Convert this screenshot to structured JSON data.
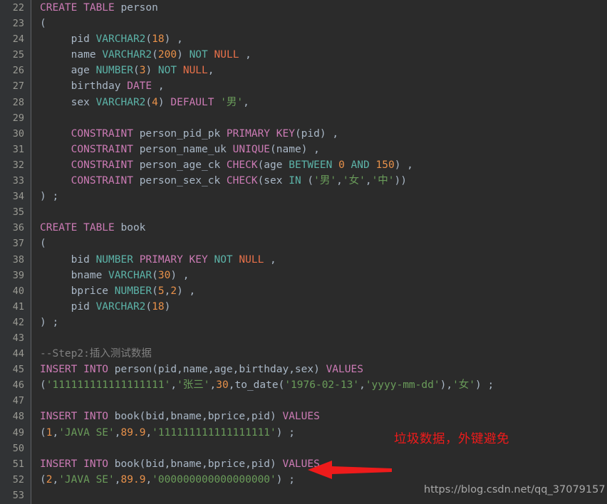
{
  "editor": {
    "background_color": "#2b2b2b",
    "gutter_color": "#313335",
    "gutter_rule_color": "#606366",
    "default_text_color": "#a9b7c6",
    "token_colors": {
      "keyword": "#cc7bb5",
      "type": "#5cb3a8",
      "null": "#e8714a",
      "number": "#e8914a",
      "string": "#6a9c5a",
      "comment": "#808080",
      "line_number": "#9a9a93"
    },
    "first_line_number": 22,
    "last_line_number": 53,
    "lines": [
      {
        "n": "22",
        "tokens": [
          {
            "t": "CREATE TABLE",
            "c": "kw"
          },
          {
            "t": " person",
            "c": "plain"
          }
        ]
      },
      {
        "n": "23",
        "tokens": [
          {
            "t": "(",
            "c": "paren"
          }
        ]
      },
      {
        "n": "24",
        "tokens": [
          {
            "t": "     pid ",
            "c": "plain"
          },
          {
            "t": "VARCHAR2",
            "c": "type"
          },
          {
            "t": "(",
            "c": "plain"
          },
          {
            "t": "18",
            "c": "num"
          },
          {
            "t": ") ,",
            "c": "plain"
          }
        ]
      },
      {
        "n": "25",
        "tokens": [
          {
            "t": "     name ",
            "c": "plain"
          },
          {
            "t": "VARCHAR2",
            "c": "type"
          },
          {
            "t": "(",
            "c": "plain"
          },
          {
            "t": "200",
            "c": "num"
          },
          {
            "t": ") ",
            "c": "plain"
          },
          {
            "t": "NOT",
            "c": "type"
          },
          {
            "t": " ",
            "c": "plain"
          },
          {
            "t": "NULL",
            "c": "null"
          },
          {
            "t": " ,",
            "c": "plain"
          }
        ]
      },
      {
        "n": "26",
        "tokens": [
          {
            "t": "     age ",
            "c": "plain"
          },
          {
            "t": "NUMBER",
            "c": "type"
          },
          {
            "t": "(",
            "c": "plain"
          },
          {
            "t": "3",
            "c": "num"
          },
          {
            "t": ") ",
            "c": "plain"
          },
          {
            "t": "NOT",
            "c": "type"
          },
          {
            "t": " ",
            "c": "plain"
          },
          {
            "t": "NULL",
            "c": "null"
          },
          {
            "t": ",",
            "c": "plain"
          }
        ]
      },
      {
        "n": "27",
        "tokens": [
          {
            "t": "     birthday ",
            "c": "plain"
          },
          {
            "t": "DATE",
            "c": "kw"
          },
          {
            "t": " ,",
            "c": "plain"
          }
        ]
      },
      {
        "n": "28",
        "tokens": [
          {
            "t": "     sex ",
            "c": "plain"
          },
          {
            "t": "VARCHAR2",
            "c": "type"
          },
          {
            "t": "(",
            "c": "plain"
          },
          {
            "t": "4",
            "c": "num"
          },
          {
            "t": ") ",
            "c": "plain"
          },
          {
            "t": "DEFAULT",
            "c": "kw"
          },
          {
            "t": " ",
            "c": "plain"
          },
          {
            "t": "'男'",
            "c": "str"
          },
          {
            "t": ",",
            "c": "plain"
          }
        ]
      },
      {
        "n": "29",
        "tokens": []
      },
      {
        "n": "30",
        "tokens": [
          {
            "t": "     ",
            "c": "plain"
          },
          {
            "t": "CONSTRAINT",
            "c": "kw"
          },
          {
            "t": " person_pid_pk ",
            "c": "plain"
          },
          {
            "t": "PRIMARY KEY",
            "c": "kw"
          },
          {
            "t": "(pid) ,",
            "c": "plain"
          }
        ]
      },
      {
        "n": "31",
        "tokens": [
          {
            "t": "     ",
            "c": "plain"
          },
          {
            "t": "CONSTRAINT",
            "c": "kw"
          },
          {
            "t": " person_name_uk ",
            "c": "plain"
          },
          {
            "t": "UNIQUE",
            "c": "kw"
          },
          {
            "t": "(name) ,",
            "c": "plain"
          }
        ]
      },
      {
        "n": "32",
        "tokens": [
          {
            "t": "     ",
            "c": "plain"
          },
          {
            "t": "CONSTRAINT",
            "c": "kw"
          },
          {
            "t": " person_age_ck ",
            "c": "plain"
          },
          {
            "t": "CHECK",
            "c": "kw"
          },
          {
            "t": "(age ",
            "c": "plain"
          },
          {
            "t": "BETWEEN",
            "c": "type"
          },
          {
            "t": " ",
            "c": "plain"
          },
          {
            "t": "0",
            "c": "num"
          },
          {
            "t": " ",
            "c": "plain"
          },
          {
            "t": "AND",
            "c": "type"
          },
          {
            "t": " ",
            "c": "plain"
          },
          {
            "t": "150",
            "c": "num"
          },
          {
            "t": ") ,",
            "c": "plain"
          }
        ]
      },
      {
        "n": "33",
        "tokens": [
          {
            "t": "     ",
            "c": "plain"
          },
          {
            "t": "CONSTRAINT",
            "c": "kw"
          },
          {
            "t": " person_sex_ck ",
            "c": "plain"
          },
          {
            "t": "CHECK",
            "c": "kw"
          },
          {
            "t": "(sex ",
            "c": "plain"
          },
          {
            "t": "IN",
            "c": "type"
          },
          {
            "t": " (",
            "c": "plain"
          },
          {
            "t": "'男'",
            "c": "str"
          },
          {
            "t": ",",
            "c": "plain"
          },
          {
            "t": "'女'",
            "c": "str"
          },
          {
            "t": ",",
            "c": "plain"
          },
          {
            "t": "'中'",
            "c": "str"
          },
          {
            "t": "))",
            "c": "plain"
          }
        ]
      },
      {
        "n": "34",
        "tokens": [
          {
            "t": ") ;",
            "c": "plain"
          }
        ]
      },
      {
        "n": "35",
        "tokens": []
      },
      {
        "n": "36",
        "tokens": [
          {
            "t": "CREATE TABLE",
            "c": "kw"
          },
          {
            "t": " book",
            "c": "plain"
          }
        ]
      },
      {
        "n": "37",
        "tokens": [
          {
            "t": "(",
            "c": "paren"
          }
        ]
      },
      {
        "n": "38",
        "tokens": [
          {
            "t": "     bid ",
            "c": "plain"
          },
          {
            "t": "NUMBER",
            "c": "type"
          },
          {
            "t": " ",
            "c": "plain"
          },
          {
            "t": "PRIMARY KEY",
            "c": "kw"
          },
          {
            "t": " ",
            "c": "plain"
          },
          {
            "t": "NOT",
            "c": "type"
          },
          {
            "t": " ",
            "c": "plain"
          },
          {
            "t": "NULL",
            "c": "null"
          },
          {
            "t": " ,",
            "c": "plain"
          }
        ]
      },
      {
        "n": "39",
        "tokens": [
          {
            "t": "     bname ",
            "c": "plain"
          },
          {
            "t": "VARCHAR",
            "c": "type"
          },
          {
            "t": "(",
            "c": "plain"
          },
          {
            "t": "30",
            "c": "num"
          },
          {
            "t": ") ,",
            "c": "plain"
          }
        ]
      },
      {
        "n": "40",
        "tokens": [
          {
            "t": "     bprice ",
            "c": "plain"
          },
          {
            "t": "NUMBER",
            "c": "type"
          },
          {
            "t": "(",
            "c": "plain"
          },
          {
            "t": "5",
            "c": "num"
          },
          {
            "t": ",",
            "c": "plain"
          },
          {
            "t": "2",
            "c": "num"
          },
          {
            "t": ") ,",
            "c": "plain"
          }
        ]
      },
      {
        "n": "41",
        "tokens": [
          {
            "t": "     pid ",
            "c": "plain"
          },
          {
            "t": "VARCHAR2",
            "c": "type"
          },
          {
            "t": "(",
            "c": "plain"
          },
          {
            "t": "18",
            "c": "num"
          },
          {
            "t": ")",
            "c": "plain"
          }
        ]
      },
      {
        "n": "42",
        "tokens": [
          {
            "t": ") ;",
            "c": "plain"
          }
        ]
      },
      {
        "n": "43",
        "tokens": []
      },
      {
        "n": "44",
        "tokens": [
          {
            "t": "--Step2:插入测试数据",
            "c": "cmt"
          }
        ]
      },
      {
        "n": "45",
        "tokens": [
          {
            "t": "INSERT INTO",
            "c": "kw"
          },
          {
            "t": " person(pid,name,age,birthday,sex) ",
            "c": "plain"
          },
          {
            "t": "VALUES",
            "c": "kw"
          }
        ]
      },
      {
        "n": "46",
        "tokens": [
          {
            "t": "(",
            "c": "plain"
          },
          {
            "t": "'111111111111111111'",
            "c": "str"
          },
          {
            "t": ",",
            "c": "plain"
          },
          {
            "t": "'张三'",
            "c": "str"
          },
          {
            "t": ",",
            "c": "plain"
          },
          {
            "t": "30",
            "c": "num"
          },
          {
            "t": ",to_date(",
            "c": "plain"
          },
          {
            "t": "'1976-02-13'",
            "c": "str"
          },
          {
            "t": ",",
            "c": "plain"
          },
          {
            "t": "'yyyy-mm-dd'",
            "c": "str"
          },
          {
            "t": "),",
            "c": "plain"
          },
          {
            "t": "'女'",
            "c": "str"
          },
          {
            "t": ") ;",
            "c": "plain"
          }
        ]
      },
      {
        "n": "47",
        "tokens": []
      },
      {
        "n": "48",
        "tokens": [
          {
            "t": "INSERT INTO",
            "c": "kw"
          },
          {
            "t": " book(bid,bname,bprice,pid) ",
            "c": "plain"
          },
          {
            "t": "VALUES",
            "c": "kw"
          }
        ]
      },
      {
        "n": "49",
        "tokens": [
          {
            "t": "(",
            "c": "plain"
          },
          {
            "t": "1",
            "c": "num"
          },
          {
            "t": ",",
            "c": "plain"
          },
          {
            "t": "'JAVA SE'",
            "c": "str"
          },
          {
            "t": ",",
            "c": "plain"
          },
          {
            "t": "89.9",
            "c": "num"
          },
          {
            "t": ",",
            "c": "plain"
          },
          {
            "t": "'111111111111111111'",
            "c": "str"
          },
          {
            "t": ") ;",
            "c": "plain"
          }
        ]
      },
      {
        "n": "50",
        "tokens": []
      },
      {
        "n": "51",
        "tokens": [
          {
            "t": "INSERT INTO",
            "c": "kw"
          },
          {
            "t": " book(bid,bname,bprice,pid) ",
            "c": "plain"
          },
          {
            "t": "VALUES",
            "c": "kw"
          }
        ]
      },
      {
        "n": "52",
        "tokens": [
          {
            "t": "(",
            "c": "plain"
          },
          {
            "t": "2",
            "c": "num"
          },
          {
            "t": ",",
            "c": "plain"
          },
          {
            "t": "'JAVA SE'",
            "c": "str"
          },
          {
            "t": ",",
            "c": "plain"
          },
          {
            "t": "89.9",
            "c": "num"
          },
          {
            "t": ",",
            "c": "plain"
          },
          {
            "t": "'000000000000000000'",
            "c": "str"
          },
          {
            "t": ") ;",
            "c": "plain"
          }
        ]
      },
      {
        "n": "53",
        "tokens": []
      }
    ]
  },
  "annotation": {
    "text": "垃圾数据，外键避免",
    "color": "#ee1b1b",
    "arrow_color": "#ee1b1b",
    "arrow_direction": "left"
  },
  "watermark": {
    "text": "https://blog.csdn.net/qq_37079157",
    "color": "#a8a8a8"
  }
}
